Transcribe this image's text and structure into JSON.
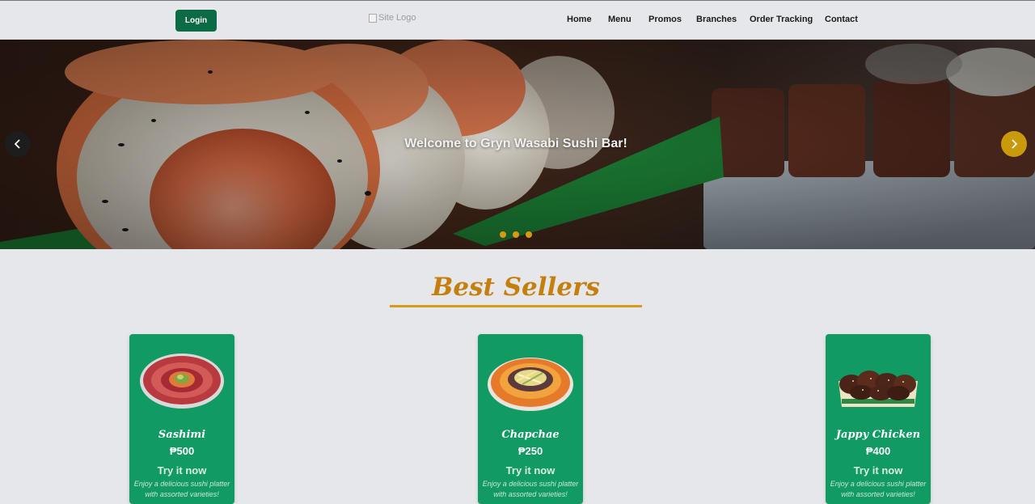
{
  "header": {
    "login_label": "Login",
    "logo_alt": "Site Logo",
    "nav": [
      {
        "label": "Home"
      },
      {
        "label": "Menu"
      },
      {
        "label": "Promos"
      },
      {
        "label": "Branches"
      },
      {
        "label": "Order Tracking"
      },
      {
        "label": "Contact"
      }
    ]
  },
  "hero": {
    "caption": "Welcome to Gryn Wasabi Sushi Bar!",
    "prev_icon": "chevron-left-icon",
    "next_icon": "chevron-right-icon",
    "slide_count": 3
  },
  "best_sellers": {
    "title": "Best Sellers",
    "items": [
      {
        "name": "Sashimi",
        "price": "₱500",
        "cta": "Try it now",
        "description": "Enjoy a delicious sushi platter with assorted varieties!"
      },
      {
        "name": "Chapchae",
        "price": "₱250",
        "cta": "Try it now",
        "description": "Enjoy a delicious sushi platter with assorted varieties!"
      },
      {
        "name": "Jappy Chicken",
        "price": "₱400",
        "cta": "Try it now",
        "description": "Enjoy a delicious sushi platter with assorted varieties!"
      }
    ]
  },
  "colors": {
    "brand_green": "#0b6b45",
    "card_green": "#119a61",
    "gold": "#c57f0d",
    "background": "#e6e7ea"
  }
}
